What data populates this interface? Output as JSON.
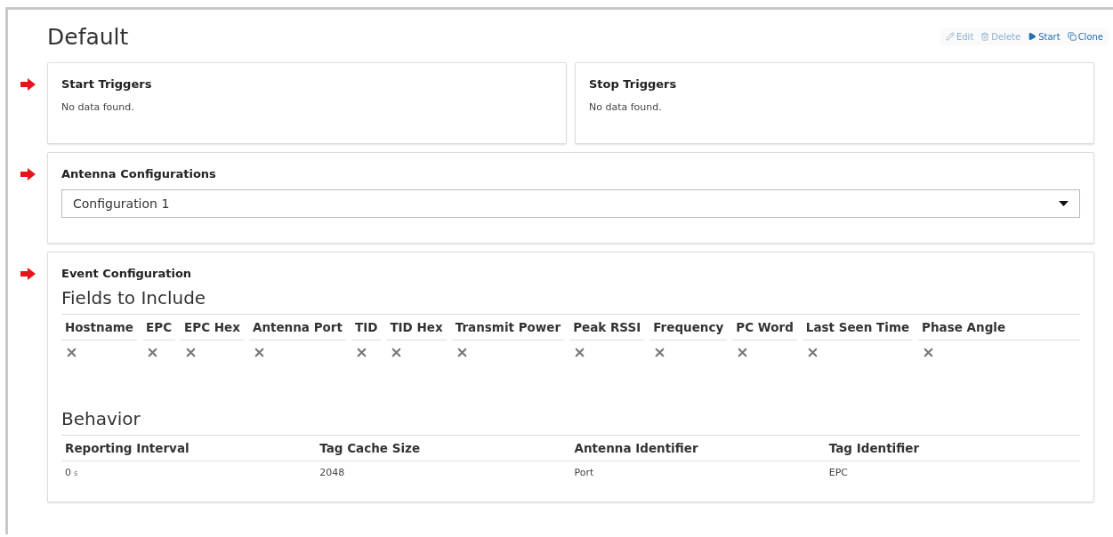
{
  "title": "Default",
  "actions": [
    {
      "label": "Edit",
      "kind": "edit",
      "disabled": true
    },
    {
      "label": "Delete",
      "kind": "delete",
      "disabled": true
    },
    {
      "label": "Start",
      "kind": "start",
      "disabled": false
    },
    {
      "label": "Clone",
      "kind": "clone",
      "disabled": false
    }
  ],
  "triggers": {
    "marked": true,
    "panels": [
      {
        "title": "Start Triggers",
        "message": "No data found."
      },
      {
        "title": "Stop Triggers",
        "message": "No data found."
      }
    ]
  },
  "antenna": {
    "title": "Antenna Configurations",
    "marked": true,
    "value": "Configuration 1"
  },
  "event": {
    "title": "Event Configuration",
    "marked": true,
    "fields_heading": "Fields to Include",
    "fields": [
      {
        "label": "Hostname",
        "included": false
      },
      {
        "label": "EPC",
        "included": false
      },
      {
        "label": "EPC Hex",
        "included": false
      },
      {
        "label": "Antenna Port",
        "included": false
      },
      {
        "label": "TID",
        "included": false
      },
      {
        "label": "TID Hex",
        "included": false
      },
      {
        "label": "Transmit Power",
        "included": false
      },
      {
        "label": "Peak RSSI",
        "included": false
      },
      {
        "label": "Frequency",
        "included": false
      },
      {
        "label": "PC Word",
        "included": false
      },
      {
        "label": "Last Seen Time",
        "included": false
      },
      {
        "label": "Phase Angle",
        "included": false
      }
    ],
    "behavior_heading": "Behavior",
    "behavior": [
      {
        "label": "Reporting Interval",
        "value": "0",
        "unit": "s"
      },
      {
        "label": "Tag Cache Size",
        "value": "2048"
      },
      {
        "label": "Antenna Identifier",
        "value": "Port"
      },
      {
        "label": "Tag Identifier",
        "value": "EPC"
      }
    ]
  }
}
